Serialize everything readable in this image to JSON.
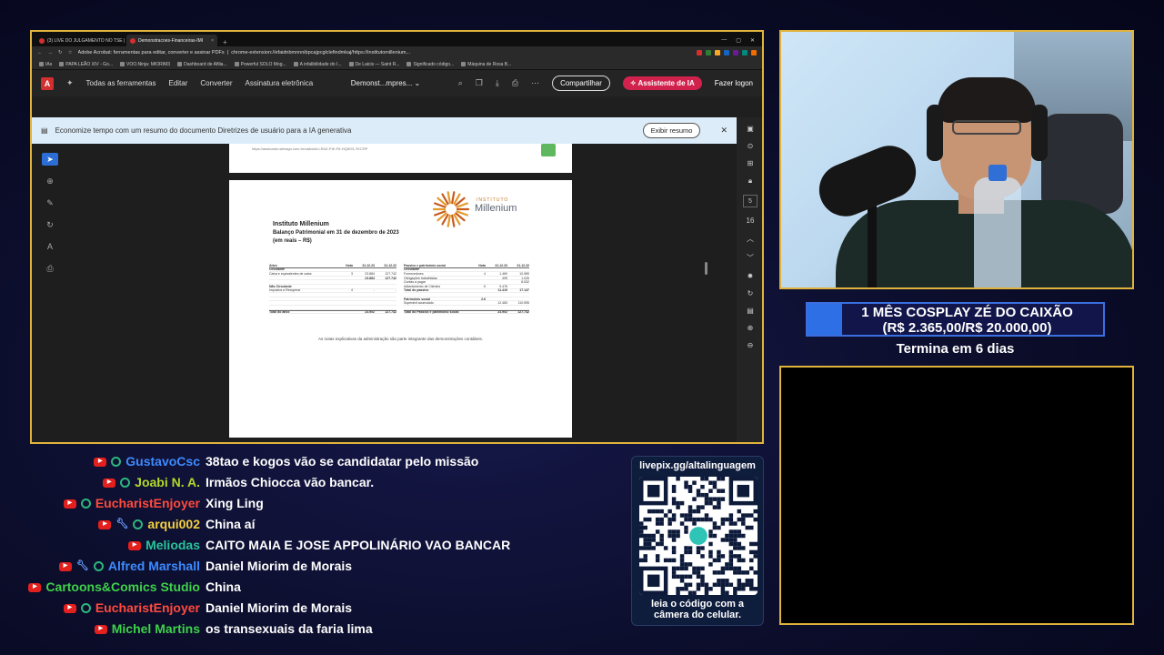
{
  "browser": {
    "tabs": [
      {
        "label": "(3) LIVE DO JULGAMENTO NO TSE |",
        "active": false
      },
      {
        "label": "Demonstracoes-Financeiras-IMI",
        "active": true
      }
    ],
    "address_title": "Adobe Acrobat: ferramentas para editar, converter e assinar PDFs",
    "address_url": "chrome-extension://efaidnbmnnnibpcajpcglclefindmkaj/https://institutomillenium...",
    "bookmarks": [
      "IAs",
      "PAPA LEÃO XIV - Go...",
      "VOO.Ninja: MIORIM3",
      "Dashboard de Afilia...",
      "Powerful SOLO Mog...",
      "A infalibilidade do I...",
      "De Laicis — Saint R...",
      "Significado código...",
      "Máquina de Rosa B..."
    ],
    "extension_colors": [
      "#d32f2f",
      "#2e7d32",
      "#f9a825",
      "#1565c0",
      "#6a1b9a",
      "#00897b",
      "#ef6c00"
    ]
  },
  "acrobat": {
    "menu": [
      "Todas as ferramentas",
      "Editar",
      "Converter",
      "Assinatura eletrônica"
    ],
    "doc_title": "Demonst...mpres...",
    "share_label": "Compartilhar",
    "ai_label": "Assistente de IA",
    "login_label": "Fazer logon",
    "banner_text": "Economize tempo com um resumo do documento Diretrizes de usuário para a IA generativa",
    "banner_button": "Exibir resumo",
    "page_current": "5",
    "page_total": "16"
  },
  "document": {
    "sig_url": "https://assinador.sitesign.com.br/validar/LLRAZ-PIK-F6-HQ8O3-YKCRP",
    "logo_instituto": "INSTITUTO",
    "logo_name": "Millenium",
    "org_name": "Instituto Millenium",
    "title": "Balanço Patrimonial em 31 de dezembro de 2023",
    "unit": "(em reais – R$)",
    "notes": "As notas explicativas da administração são parte integrante das demonstrações contábeis.",
    "assets": [
      {
        "label": "Ativo",
        "nota": "Nota",
        "y2023": "31.12.23",
        "y2022": "31.12.22",
        "kind": "hd"
      },
      {
        "label": "Circulante",
        "nota": "",
        "y2023": "",
        "y2022": "",
        "kind": "b"
      },
      {
        "label": "Caixa e equivalentes de caixa",
        "nota": "3",
        "y2023": "23.884",
        "y2022": "127.742",
        "kind": ""
      },
      {
        "label": "",
        "nota": "",
        "y2023": "23.884",
        "y2022": "127.742",
        "kind": "b"
      },
      {
        "label": "",
        "nota": "",
        "y2023": "",
        "y2022": "",
        "kind": ""
      },
      {
        "label": "Não Circulante",
        "nota": "",
        "y2023": "",
        "y2022": "",
        "kind": "b"
      },
      {
        "label": "Impostos a Recuperar",
        "nota": "4",
        "y2023": "-",
        "y2022": "-",
        "kind": ""
      },
      {
        "label": "",
        "nota": "",
        "y2023": "",
        "y2022": "",
        "kind": ""
      },
      {
        "label": "",
        "nota": "",
        "y2023": "",
        "y2022": "",
        "kind": ""
      },
      {
        "label": "",
        "nota": "",
        "y2023": "",
        "y2022": "",
        "kind": ""
      },
      {
        "label": "",
        "nota": "",
        "y2023": "",
        "y2022": "",
        "kind": ""
      },
      {
        "label": "Total do ativo",
        "nota": "",
        "y2023": "23.902",
        "y2022": "127.742",
        "kind": "tot"
      }
    ],
    "liabilities": [
      {
        "label": "Passivo e patrimônio social",
        "nota": "Nota",
        "y2023": "31.12.23",
        "y2022": "31.12.22",
        "kind": "hd"
      },
      {
        "label": "Circulante",
        "nota": "",
        "y2023": "",
        "y2022": "",
        "kind": "b"
      },
      {
        "label": "Fornecedores",
        "nota": "4",
        "y2023": "1.469",
        "y2022": "10.989",
        "kind": ""
      },
      {
        "label": "Obrigações trabalhistas",
        "nota": "",
        "y2023": "495",
        "y2022": "1.026",
        "kind": ""
      },
      {
        "label": "Contas a pagar",
        "nota": "",
        "y2023": "",
        "y2022": "8.532",
        "kind": ""
      },
      {
        "label": "Adiantamento de Clientes",
        "nota": "5",
        "y2023": "9.476",
        "y2022": "",
        "kind": ""
      },
      {
        "label": "Total do passivo",
        "nota": "",
        "y2023": "11.419",
        "y2022": "17.147",
        "kind": "b"
      },
      {
        "label": "",
        "nota": "",
        "y2023": "",
        "y2022": "",
        "kind": ""
      },
      {
        "label": "Patrimônio social",
        "nota": "2.6",
        "y2023": "",
        "y2022": "",
        "kind": "b"
      },
      {
        "label": "Superávit acumulado",
        "nota": "",
        "y2023": "12.483",
        "y2022": "110.595",
        "kind": ""
      },
      {
        "label": "",
        "nota": "",
        "y2023": "",
        "y2022": "",
        "kind": ""
      },
      {
        "label": "Total do Passivo e patrimônio social",
        "nota": "",
        "y2023": "23.902",
        "y2022": "127.742",
        "kind": "tot"
      }
    ]
  },
  "goal": {
    "title": "1 MÊS COSPLAY ZÉ DO CAIXÃO",
    "amount": "(R$ 2.365,00/R$ 20.000,00)",
    "progress": 0.118,
    "ends": "Termina em 6 dias"
  },
  "chat": [
    {
      "user": "GustavoCsc",
      "color": "#3d8bff",
      "badges": [
        "youtube",
        "verified"
      ],
      "message": "38tao e kogos vão se candidatar pelo missão"
    },
    {
      "user": "Joabi N. A.",
      "color": "#b5d82a",
      "badges": [
        "youtube",
        "verified"
      ],
      "message": "Irmãos Chiocca vão bancar."
    },
    {
      "user": "EucharistEnjoyer",
      "color": "#ff4a3d",
      "badges": [
        "youtube",
        "verified"
      ],
      "message": "Xing Ling"
    },
    {
      "user": "arqui002",
      "color": "#f4d03f",
      "badges": [
        "youtube",
        "wrench",
        "verified"
      ],
      "message": "China aí"
    },
    {
      "user": "Meliodas",
      "color": "#29c49a",
      "badges": [
        "youtube"
      ],
      "message": "CAITO MAIA E JOSE APPOLINÁRIO VAO BANCAR"
    },
    {
      "user": "Alfred Marshall",
      "color": "#3d8bff",
      "badges": [
        "youtube",
        "wrench",
        "verified"
      ],
      "message": "Daniel Miorim de Morais"
    },
    {
      "user": "Cartoons&Comics Studio",
      "color": "#3fd14a",
      "badges": [
        "youtube"
      ],
      "message": "China"
    },
    {
      "user": "EucharistEnjoyer",
      "color": "#ff4a3d",
      "badges": [
        "youtube",
        "verified"
      ],
      "message": "Daniel Miorim de Morais"
    },
    {
      "user": "Michel Martins",
      "color": "#3fd14a",
      "badges": [
        "youtube"
      ],
      "message": "os transexuais da faria lima"
    }
  ],
  "qr": {
    "url": "livepix.gg/altalinguagem",
    "caption": "leia o código com a câmera do celular."
  }
}
